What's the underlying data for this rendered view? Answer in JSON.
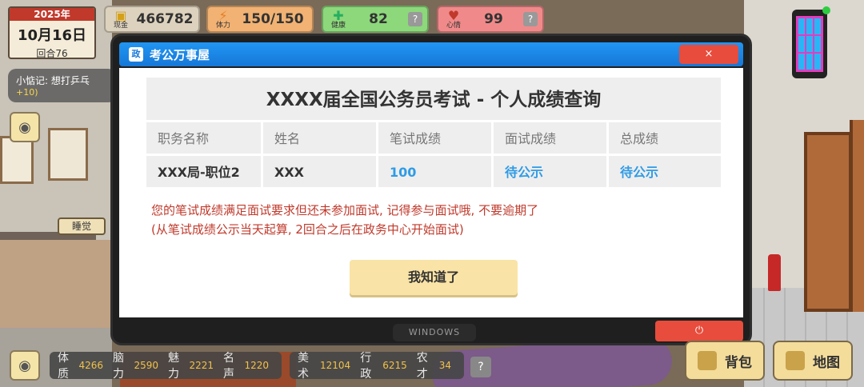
{
  "hud": {
    "year": "2025年",
    "date": "10月16日",
    "round": "回合76",
    "cash": {
      "label": "现金",
      "value": "466782"
    },
    "stamina": {
      "label": "体力",
      "value": "150/150"
    },
    "health": {
      "label": "健康",
      "value": "82",
      "help": "?"
    },
    "mood": {
      "label": "心情",
      "value": "99",
      "help": "?"
    }
  },
  "notice": {
    "line1": "小惦记: 想打乒乓",
    "line2": "+10)"
  },
  "scene": {
    "sleep_label": "睡觉"
  },
  "window": {
    "app_icon": "政",
    "title": "考公万事屋",
    "close": "×",
    "taskbar": "WINDOWS",
    "power": "⏻"
  },
  "table": {
    "title": "XXXX届全国公务员考试 - 个人成绩查询",
    "headers": [
      "职务名称",
      "姓名",
      "笔试成绩",
      "面试成绩",
      "总成绩"
    ],
    "row": [
      "XXX局-职位2",
      "XXX",
      "100",
      "待公示",
      "待公示"
    ]
  },
  "message": {
    "line1": "您的笔试成绩满足面试要求但还未参加面试, 记得参与面试哦, 不要逾期了",
    "line2": "(从笔试成绩公示当天起算, 2回合之后在政务中心开始面试)"
  },
  "ok_button": "我知道了",
  "stats": {
    "group1": [
      {
        "label": "体质",
        "value": "4266"
      },
      {
        "label": "脑力",
        "value": "2590"
      },
      {
        "label": "魅力",
        "value": "2221"
      },
      {
        "label": "名声",
        "value": "1220"
      }
    ],
    "group2": [
      {
        "label": "美术",
        "value": "12104"
      },
      {
        "label": "行政",
        "value": "6215"
      },
      {
        "label": "农才",
        "value": "34"
      }
    ],
    "help": "?"
  },
  "buttons": {
    "bag": "背包",
    "map": "地图"
  },
  "colors": {
    "accent_blue": "#1677d8",
    "alert_red": "#c0392b",
    "value_blue": "#2e9be6"
  }
}
